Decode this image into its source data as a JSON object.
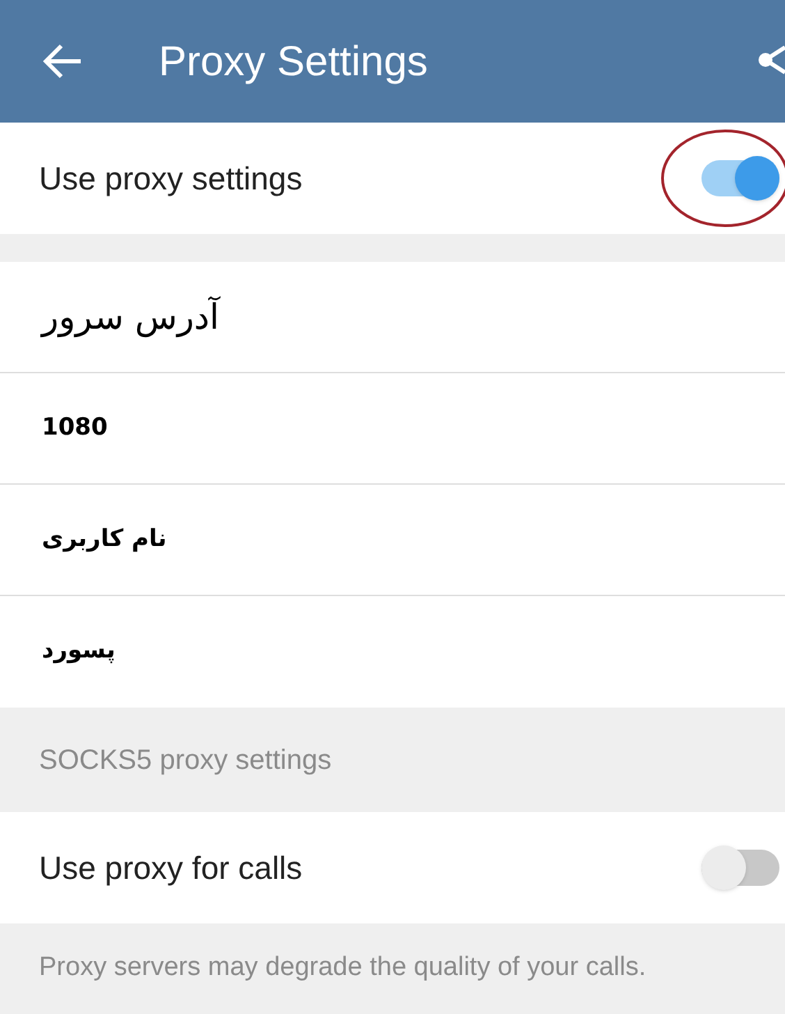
{
  "app_bar": {
    "title": "Proxy Settings"
  },
  "proxy_toggle": {
    "label": "Use proxy settings",
    "on": true,
    "highlighted": true
  },
  "fields": [
    {
      "kind": "large",
      "value": "آدرس سرور"
    },
    {
      "kind": "bold",
      "value": "1080"
    },
    {
      "kind": "bold",
      "value": "نام کاربری"
    },
    {
      "kind": "bold",
      "value": "پسورد"
    }
  ],
  "section_note": "SOCKS5 proxy settings",
  "calls_toggle": {
    "label": "Use proxy for calls",
    "on": false
  },
  "footer_note": "Proxy servers may degrade the quality of your calls."
}
